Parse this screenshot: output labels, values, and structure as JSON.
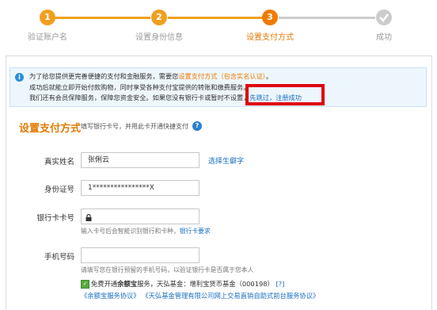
{
  "steps": [
    {
      "number": "1",
      "label": "验证账户名",
      "state": "done"
    },
    {
      "number": "2",
      "label": "设置身份信息",
      "state": "done"
    },
    {
      "number": "3",
      "label": "设置支付方式",
      "state": "active"
    },
    {
      "number": "",
      "label": "成功",
      "state": "pending"
    }
  ],
  "notice": {
    "line1_a": "为了给您提供更完善便捷的支付和金融服务，需要您",
    "line1_b": "设置支付方式（包含实名认证）",
    "line1_c": "。",
    "line2": "成功后就能立即开始付款购物，同时享受各种支付宝提供的转账和缴费服务。",
    "line3_a": "我们还有会员保障服务，保障您资金安全。如果您没有银行卡或暂时不设置，",
    "line3_link": "先跳过，注册成功"
  },
  "section": {
    "title": "设置支付方式",
    "hint": "填写银行卡号，并用此卡开通快捷支付"
  },
  "form": {
    "name_label": "真实姓名",
    "name_value": "张俐云",
    "rare_char_link": "选择生僻字",
    "id_label": "身份证号",
    "id_value": "1****************X",
    "card_label": "银行卡卡号",
    "card_hint_a": "输入卡号后会智能识别银行和卡种，",
    "card_hint_link": "银行卡要求",
    "phone_label": "手机号码",
    "phone_hint": "请填写您在银行预留的手机号码，以验证银行卡是否属于您本人"
  },
  "agreement": {
    "line1_a": "免费开通",
    "line1_b": "余额宝",
    "line1_c": "服务，天弘基金：增利宝货币基金（000198）",
    "line1_q": "[?]",
    "line2": "《余额宝服务协议》 《天弘基金管理有限公司网上交易直销自助式前台服务协议》"
  },
  "colors": {
    "step_orange": "#f0a020",
    "step_gray": "#cccccc",
    "accent_orange": "#e17b05",
    "highlight_red": "#e0000f",
    "link_blue": "#1a6fc2"
  }
}
